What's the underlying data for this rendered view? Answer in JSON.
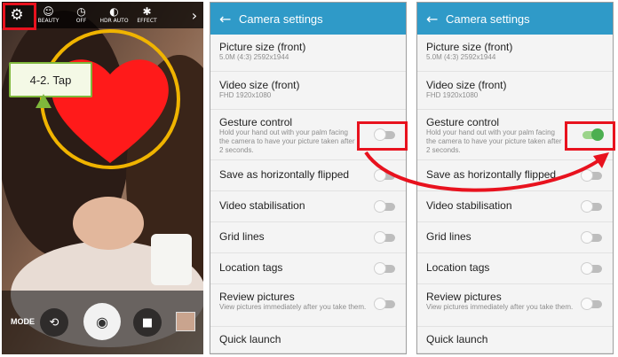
{
  "camera": {
    "toolbar": {
      "settings_icon": "gear-icon",
      "items": [
        {
          "icon": "beauty-icon",
          "label": "BEAUTY"
        },
        {
          "icon": "timer-icon",
          "label": "OFF"
        },
        {
          "icon": "hdr-icon",
          "label": "HDR AUTO"
        },
        {
          "icon": "effect-icon",
          "label": "EFFECT"
        }
      ],
      "more_icon": "chevron-right-icon"
    },
    "callout": "4-2. Tap",
    "bottom": {
      "mode_label": "MODE"
    },
    "colors": {
      "highlight": "#e8121e",
      "heart": "#ff1a1a",
      "ring": "#f0b400"
    }
  },
  "settings_before": {
    "title": "Camera settings",
    "items": [
      {
        "title": "Picture size (front)",
        "subtitle": "5.0M (4:3) 2592x1944"
      },
      {
        "title": "Video size (front)",
        "subtitle": "FHD 1920x1080"
      },
      {
        "title": "Gesture control",
        "subtitle": "Hold your hand out with your palm facing the camera to have your picture taken after 2 seconds.",
        "toggle": "off"
      },
      {
        "title": "Save as horizontally flipped",
        "toggle": "off"
      },
      {
        "title": "Video stabilisation",
        "toggle": "off"
      },
      {
        "title": "Grid lines",
        "toggle": "off"
      },
      {
        "title": "Location tags",
        "toggle": "off"
      },
      {
        "title": "Review pictures",
        "subtitle": "View pictures immediately after you take them.",
        "toggle": "off"
      },
      {
        "title": "Quick launch"
      }
    ]
  },
  "settings_after": {
    "title": "Camera settings",
    "items": [
      {
        "title": "Picture size (front)",
        "subtitle": "5.0M (4:3) 2592x1944"
      },
      {
        "title": "Video size (front)",
        "subtitle": "FHD 1920x1080"
      },
      {
        "title": "Gesture control",
        "subtitle": "Hold your hand out with your palm facing the camera to have your picture taken after 2 seconds.",
        "toggle": "on"
      },
      {
        "title": "Save as horizontally flipped",
        "toggle": "off"
      },
      {
        "title": "Video stabilisation",
        "toggle": "off"
      },
      {
        "title": "Grid lines",
        "toggle": "off"
      },
      {
        "title": "Location tags",
        "toggle": "off"
      },
      {
        "title": "Review pictures",
        "subtitle": "View pictures immediately after you take them.",
        "toggle": "off"
      },
      {
        "title": "Quick launch"
      }
    ]
  },
  "colors": {
    "appbar": "#2f9ac8",
    "toggle_on": "#4caf50",
    "annotation": "#e8121e"
  }
}
